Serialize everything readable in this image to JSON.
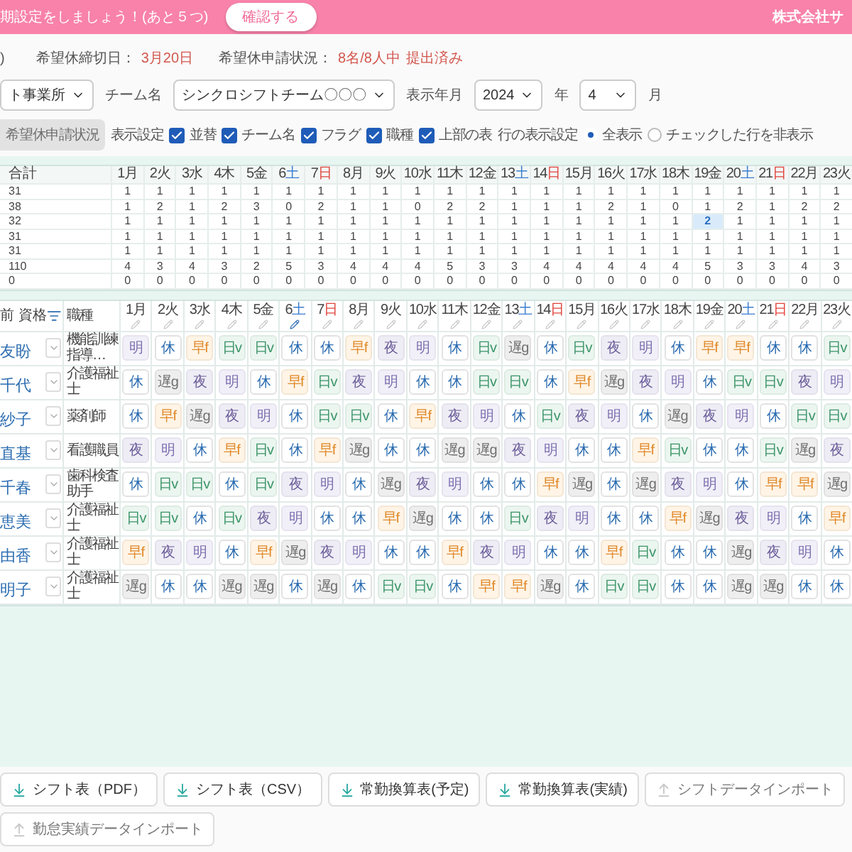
{
  "top_bar": {
    "message": "期設定をしましょう！(あと５つ)",
    "confirm_button": "確認する",
    "company": "株式会社サ"
  },
  "info": {
    "prefix": ")",
    "deadline_label": "希望休締切日：",
    "deadline": "3月20日",
    "status_label": "希望休申請状況：",
    "status_count": "8名/8人中",
    "status_text": "提出済み"
  },
  "filters": {
    "office": "ト事業所",
    "team_label": "チーム名",
    "team": "シンクロシフトチーム〇〇〇",
    "period_label": "表示年月",
    "year": "2024",
    "year_unit": "年",
    "month": "4",
    "month_unit": "月"
  },
  "settings": {
    "request_button": {
      "label": "希望休申請状況",
      "disabled": true
    },
    "display_label": "表示設定",
    "checkboxes": [
      {
        "label": "並替",
        "checked": true
      },
      {
        "label": "チーム名",
        "checked": true
      },
      {
        "label": "フラグ",
        "checked": true
      },
      {
        "label": "職種",
        "checked": true
      },
      {
        "label": "上部の表",
        "checked": true
      }
    ],
    "row_label": "行の表示設定",
    "radios": [
      {
        "label": "全表示",
        "selected": true
      },
      {
        "label": "チェックした行を非表示",
        "selected": false
      }
    ]
  },
  "summary": {
    "total_header": "合計",
    "columns": [
      {
        "day": "1",
        "weekday": "月",
        "kind": "weekday"
      },
      {
        "day": "2",
        "weekday": "火",
        "kind": "weekday"
      },
      {
        "day": "3",
        "weekday": "水",
        "kind": "weekday"
      },
      {
        "day": "4",
        "weekday": "木",
        "kind": "weekday"
      },
      {
        "day": "5",
        "weekday": "金",
        "kind": "weekday"
      },
      {
        "day": "6",
        "weekday": "土",
        "kind": "sat"
      },
      {
        "day": "7",
        "weekday": "日",
        "kind": "sun"
      },
      {
        "day": "8",
        "weekday": "月",
        "kind": "weekday"
      },
      {
        "day": "9",
        "weekday": "火",
        "kind": "weekday"
      },
      {
        "day": "10",
        "weekday": "水",
        "kind": "weekday"
      },
      {
        "day": "11",
        "weekday": "木",
        "kind": "weekday"
      },
      {
        "day": "12",
        "weekday": "金",
        "kind": "weekday"
      },
      {
        "day": "13",
        "weekday": "土",
        "kind": "sat"
      },
      {
        "day": "14",
        "weekday": "日",
        "kind": "sun"
      },
      {
        "day": "15",
        "weekday": "月",
        "kind": "weekday"
      },
      {
        "day": "16",
        "weekday": "火",
        "kind": "weekday"
      },
      {
        "day": "17",
        "weekday": "水",
        "kind": "weekday"
      },
      {
        "day": "18",
        "weekday": "木",
        "kind": "weekday"
      },
      {
        "day": "19",
        "weekday": "金",
        "kind": "weekday"
      },
      {
        "day": "20",
        "weekday": "土",
        "kind": "sat"
      },
      {
        "day": "21",
        "weekday": "日",
        "kind": "sun"
      },
      {
        "day": "22",
        "weekday": "月",
        "kind": "weekday"
      },
      {
        "day": "23",
        "weekday": "火",
        "kind": "weekday"
      }
    ],
    "rows": [
      {
        "total": "31",
        "values": [
          "1",
          "1",
          "1",
          "1",
          "1",
          "1",
          "1",
          "1",
          "1",
          "1",
          "1",
          "1",
          "1",
          "1",
          "1",
          "1",
          "1",
          "1",
          "1",
          "1",
          "1",
          "1",
          "1"
        ],
        "highlighted": [
          false,
          false,
          false,
          false,
          false,
          false,
          false,
          false,
          false,
          false,
          false,
          false,
          false,
          false,
          false,
          false,
          false,
          false,
          false,
          false,
          false,
          false,
          false
        ]
      },
      {
        "total": "38",
        "values": [
          "1",
          "2",
          "1",
          "2",
          "3",
          "0",
          "2",
          "1",
          "1",
          "0",
          "2",
          "2",
          "1",
          "1",
          "1",
          "2",
          "1",
          "0",
          "1",
          "2",
          "1",
          "2",
          "2"
        ],
        "highlighted": [
          false,
          false,
          false,
          false,
          false,
          false,
          false,
          false,
          false,
          false,
          false,
          false,
          false,
          false,
          false,
          false,
          false,
          false,
          false,
          false,
          false,
          false,
          false
        ]
      },
      {
        "total": "32",
        "values": [
          "1",
          "1",
          "1",
          "1",
          "1",
          "1",
          "1",
          "1",
          "1",
          "1",
          "1",
          "1",
          "1",
          "1",
          "1",
          "1",
          "1",
          "1",
          "2",
          "1",
          "1",
          "1",
          "1"
        ],
        "highlighted": [
          false,
          false,
          false,
          false,
          false,
          false,
          false,
          false,
          false,
          false,
          false,
          false,
          false,
          false,
          false,
          false,
          false,
          false,
          true,
          false,
          false,
          false,
          false
        ]
      },
      {
        "total": "31",
        "values": [
          "1",
          "1",
          "1",
          "1",
          "1",
          "1",
          "1",
          "1",
          "1",
          "1",
          "1",
          "1",
          "1",
          "1",
          "1",
          "1",
          "1",
          "1",
          "1",
          "1",
          "1",
          "1",
          "1"
        ],
        "highlighted": [
          false,
          false,
          false,
          false,
          false,
          false,
          false,
          false,
          false,
          false,
          false,
          false,
          false,
          false,
          false,
          false,
          false,
          false,
          false,
          false,
          false,
          false,
          false
        ]
      },
      {
        "total": "31",
        "values": [
          "1",
          "1",
          "1",
          "1",
          "1",
          "1",
          "1",
          "1",
          "1",
          "1",
          "1",
          "1",
          "1",
          "1",
          "1",
          "1",
          "1",
          "1",
          "1",
          "1",
          "1",
          "1",
          "1"
        ],
        "highlighted": [
          false,
          false,
          false,
          false,
          false,
          false,
          false,
          false,
          false,
          false,
          false,
          false,
          false,
          false,
          false,
          false,
          false,
          false,
          false,
          false,
          false,
          false,
          false
        ]
      },
      {
        "total": "110",
        "values": [
          "4",
          "3",
          "4",
          "3",
          "2",
          "5",
          "3",
          "4",
          "4",
          "4",
          "5",
          "3",
          "3",
          "4",
          "4",
          "4",
          "4",
          "4",
          "5",
          "3",
          "3",
          "4",
          "3"
        ],
        "highlighted": [
          false,
          false,
          false,
          false,
          false,
          false,
          false,
          false,
          false,
          false,
          false,
          false,
          false,
          false,
          false,
          false,
          false,
          false,
          false,
          false,
          false,
          false,
          false
        ]
      },
      {
        "total": "0",
        "values": [
          "0",
          "0",
          "0",
          "0",
          "0",
          "0",
          "0",
          "0",
          "0",
          "0",
          "0",
          "0",
          "0",
          "0",
          "0",
          "0",
          "0",
          "0",
          "0",
          "0",
          "0",
          "0",
          "0"
        ],
        "highlighted": [
          false,
          false,
          false,
          false,
          false,
          false,
          false,
          false,
          false,
          false,
          false,
          false,
          false,
          false,
          false,
          false,
          false,
          false,
          false,
          false,
          false,
          false,
          false
        ]
      }
    ]
  },
  "schedule": {
    "name_header": "前 資格",
    "job_header": "職種",
    "columns": [
      {
        "day": "1",
        "weekday": "月",
        "kind": "weekday",
        "selected": false
      },
      {
        "day": "2",
        "weekday": "火",
        "kind": "weekday",
        "selected": false
      },
      {
        "day": "3",
        "weekday": "水",
        "kind": "weekday",
        "selected": false
      },
      {
        "day": "4",
        "weekday": "木",
        "kind": "weekday",
        "selected": false
      },
      {
        "day": "5",
        "weekday": "金",
        "kind": "weekday",
        "selected": false
      },
      {
        "day": "6",
        "weekday": "土",
        "kind": "sat",
        "selected": true
      },
      {
        "day": "7",
        "weekday": "日",
        "kind": "sun",
        "selected": false
      },
      {
        "day": "8",
        "weekday": "月",
        "kind": "weekday",
        "selected": false
      },
      {
        "day": "9",
        "weekday": "火",
        "kind": "weekday",
        "selected": false
      },
      {
        "day": "10",
        "weekday": "水",
        "kind": "weekday",
        "selected": false
      },
      {
        "day": "11",
        "weekday": "木",
        "kind": "weekday",
        "selected": false
      },
      {
        "day": "12",
        "weekday": "金",
        "kind": "weekday",
        "selected": false
      },
      {
        "day": "13",
        "weekday": "土",
        "kind": "sat",
        "selected": false
      },
      {
        "day": "14",
        "weekday": "日",
        "kind": "sun",
        "selected": false
      },
      {
        "day": "15",
        "weekday": "月",
        "kind": "weekday",
        "selected": false
      },
      {
        "day": "16",
        "weekday": "火",
        "kind": "weekday",
        "selected": false
      },
      {
        "day": "17",
        "weekday": "水",
        "kind": "weekday",
        "selected": false
      },
      {
        "day": "18",
        "weekday": "木",
        "kind": "weekday",
        "selected": false
      },
      {
        "day": "19",
        "weekday": "金",
        "kind": "weekday",
        "selected": false
      },
      {
        "day": "20",
        "weekday": "土",
        "kind": "sat",
        "selected": false
      },
      {
        "day": "21",
        "weekday": "日",
        "kind": "sun",
        "selected": false
      },
      {
        "day": "22",
        "weekday": "月",
        "kind": "weekday",
        "selected": false
      },
      {
        "day": "23",
        "weekday": "火",
        "kind": "weekday",
        "selected": false
      }
    ],
    "rows": [
      {
        "name": "友盼",
        "job": "機能訓練指導…",
        "shifts": [
          {
            "label": "明",
            "kind": "ake"
          },
          {
            "label": "休",
            "kind": "off"
          },
          {
            "label": "早f",
            "kind": "early"
          },
          {
            "label": "日v",
            "kind": "day"
          },
          {
            "label": "日v",
            "kind": "day"
          },
          {
            "label": "休",
            "kind": "off"
          },
          {
            "label": "休",
            "kind": "off"
          },
          {
            "label": "早f",
            "kind": "early"
          },
          {
            "label": "夜",
            "kind": "night"
          },
          {
            "label": "明",
            "kind": "ake"
          },
          {
            "label": "休",
            "kind": "off"
          },
          {
            "label": "日v",
            "kind": "day"
          },
          {
            "label": "遅g",
            "kind": "late"
          },
          {
            "label": "休",
            "kind": "off"
          },
          {
            "label": "日v",
            "kind": "day"
          },
          {
            "label": "夜",
            "kind": "night"
          },
          {
            "label": "明",
            "kind": "ake"
          },
          {
            "label": "休",
            "kind": "off"
          },
          {
            "label": "早f",
            "kind": "early"
          },
          {
            "label": "早f",
            "kind": "early"
          },
          {
            "label": "休",
            "kind": "off"
          },
          {
            "label": "休",
            "kind": "off"
          },
          {
            "label": "日v",
            "kind": "day"
          }
        ]
      },
      {
        "name": "千代",
        "job": "介護福祉士",
        "shifts": [
          {
            "label": "休",
            "kind": "off"
          },
          {
            "label": "遅g",
            "kind": "late"
          },
          {
            "label": "夜",
            "kind": "night"
          },
          {
            "label": "明",
            "kind": "ake"
          },
          {
            "label": "休",
            "kind": "off"
          },
          {
            "label": "早f",
            "kind": "early"
          },
          {
            "label": "日v",
            "kind": "day"
          },
          {
            "label": "夜",
            "kind": "night"
          },
          {
            "label": "明",
            "kind": "ake"
          },
          {
            "label": "休",
            "kind": "off"
          },
          {
            "label": "休",
            "kind": "off"
          },
          {
            "label": "日v",
            "kind": "day"
          },
          {
            "label": "日v",
            "kind": "day"
          },
          {
            "label": "休",
            "kind": "off"
          },
          {
            "label": "早f",
            "kind": "early"
          },
          {
            "label": "遅g",
            "kind": "late"
          },
          {
            "label": "夜",
            "kind": "night"
          },
          {
            "label": "明",
            "kind": "ake"
          },
          {
            "label": "休",
            "kind": "off"
          },
          {
            "label": "日v",
            "kind": "day"
          },
          {
            "label": "日v",
            "kind": "day"
          },
          {
            "label": "夜",
            "kind": "night"
          },
          {
            "label": "明",
            "kind": "ake"
          }
        ]
      },
      {
        "name": "紗子",
        "job": "薬剤師",
        "shifts": [
          {
            "label": "休",
            "kind": "off"
          },
          {
            "label": "早f",
            "kind": "early"
          },
          {
            "label": "遅g",
            "kind": "late"
          },
          {
            "label": "夜",
            "kind": "night"
          },
          {
            "label": "明",
            "kind": "ake"
          },
          {
            "label": "休",
            "kind": "off"
          },
          {
            "label": "日v",
            "kind": "day"
          },
          {
            "label": "日v",
            "kind": "day"
          },
          {
            "label": "休",
            "kind": "off"
          },
          {
            "label": "早f",
            "kind": "early"
          },
          {
            "label": "夜",
            "kind": "night"
          },
          {
            "label": "明",
            "kind": "ake"
          },
          {
            "label": "休",
            "kind": "off"
          },
          {
            "label": "日v",
            "kind": "day"
          },
          {
            "label": "夜",
            "kind": "night"
          },
          {
            "label": "明",
            "kind": "ake"
          },
          {
            "label": "休",
            "kind": "off"
          },
          {
            "label": "遅g",
            "kind": "late"
          },
          {
            "label": "夜",
            "kind": "night"
          },
          {
            "label": "明",
            "kind": "ake"
          },
          {
            "label": "休",
            "kind": "off"
          },
          {
            "label": "日v",
            "kind": "day"
          },
          {
            "label": "日v",
            "kind": "day"
          }
        ]
      },
      {
        "name": "直基",
        "job": "看護職員",
        "shifts": [
          {
            "label": "夜",
            "kind": "night"
          },
          {
            "label": "明",
            "kind": "ake"
          },
          {
            "label": "休",
            "kind": "off"
          },
          {
            "label": "早f",
            "kind": "early"
          },
          {
            "label": "日v",
            "kind": "day"
          },
          {
            "label": "休",
            "kind": "off"
          },
          {
            "label": "早f",
            "kind": "early"
          },
          {
            "label": "遅g",
            "kind": "late"
          },
          {
            "label": "休",
            "kind": "off"
          },
          {
            "label": "休",
            "kind": "off"
          },
          {
            "label": "遅g",
            "kind": "late"
          },
          {
            "label": "遅g",
            "kind": "late"
          },
          {
            "label": "夜",
            "kind": "night"
          },
          {
            "label": "明",
            "kind": "ake"
          },
          {
            "label": "休",
            "kind": "off"
          },
          {
            "label": "休",
            "kind": "off"
          },
          {
            "label": "早f",
            "kind": "early"
          },
          {
            "label": "日v",
            "kind": "day"
          },
          {
            "label": "休",
            "kind": "off"
          },
          {
            "label": "休",
            "kind": "off"
          },
          {
            "label": "日v",
            "kind": "day"
          },
          {
            "label": "遅g",
            "kind": "late"
          },
          {
            "label": "夜",
            "kind": "night"
          }
        ]
      },
      {
        "name": "千春",
        "job": "歯科検査助手",
        "shifts": [
          {
            "label": "休",
            "kind": "off"
          },
          {
            "label": "日v",
            "kind": "day"
          },
          {
            "label": "日v",
            "kind": "day"
          },
          {
            "label": "休",
            "kind": "off"
          },
          {
            "label": "日v",
            "kind": "day"
          },
          {
            "label": "夜",
            "kind": "night"
          },
          {
            "label": "明",
            "kind": "ake"
          },
          {
            "label": "休",
            "kind": "off"
          },
          {
            "label": "遅g",
            "kind": "late"
          },
          {
            "label": "夜",
            "kind": "night"
          },
          {
            "label": "明",
            "kind": "ake"
          },
          {
            "label": "休",
            "kind": "off"
          },
          {
            "label": "休",
            "kind": "off"
          },
          {
            "label": "早f",
            "kind": "early"
          },
          {
            "label": "遅g",
            "kind": "late"
          },
          {
            "label": "休",
            "kind": "off"
          },
          {
            "label": "遅g",
            "kind": "late"
          },
          {
            "label": "夜",
            "kind": "night"
          },
          {
            "label": "明",
            "kind": "ake"
          },
          {
            "label": "休",
            "kind": "off"
          },
          {
            "label": "早f",
            "kind": "early"
          },
          {
            "label": "早f",
            "kind": "early"
          },
          {
            "label": "遅g",
            "kind": "late"
          }
        ]
      },
      {
        "name": "恵美",
        "job": "介護福祉士",
        "shifts": [
          {
            "label": "日v",
            "kind": "day"
          },
          {
            "label": "日v",
            "kind": "day"
          },
          {
            "label": "休",
            "kind": "off"
          },
          {
            "label": "日v",
            "kind": "day"
          },
          {
            "label": "夜",
            "kind": "night"
          },
          {
            "label": "明",
            "kind": "ake"
          },
          {
            "label": "休",
            "kind": "off"
          },
          {
            "label": "休",
            "kind": "off"
          },
          {
            "label": "早f",
            "kind": "early"
          },
          {
            "label": "遅g",
            "kind": "late"
          },
          {
            "label": "休",
            "kind": "off"
          },
          {
            "label": "休",
            "kind": "off"
          },
          {
            "label": "日v",
            "kind": "day"
          },
          {
            "label": "夜",
            "kind": "night"
          },
          {
            "label": "明",
            "kind": "ake"
          },
          {
            "label": "休",
            "kind": "off"
          },
          {
            "label": "休",
            "kind": "off"
          },
          {
            "label": "早f",
            "kind": "early"
          },
          {
            "label": "遅g",
            "kind": "late"
          },
          {
            "label": "夜",
            "kind": "night"
          },
          {
            "label": "明",
            "kind": "ake"
          },
          {
            "label": "休",
            "kind": "off"
          },
          {
            "label": "早f",
            "kind": "early"
          }
        ]
      },
      {
        "name": "由香",
        "job": "介護福祉士",
        "shifts": [
          {
            "label": "早f",
            "kind": "early"
          },
          {
            "label": "夜",
            "kind": "night"
          },
          {
            "label": "明",
            "kind": "ake"
          },
          {
            "label": "休",
            "kind": "off"
          },
          {
            "label": "早f",
            "kind": "early"
          },
          {
            "label": "遅g",
            "kind": "late"
          },
          {
            "label": "夜",
            "kind": "night"
          },
          {
            "label": "明",
            "kind": "ake"
          },
          {
            "label": "休",
            "kind": "off"
          },
          {
            "label": "休",
            "kind": "off"
          },
          {
            "label": "早f",
            "kind": "early"
          },
          {
            "label": "夜",
            "kind": "night"
          },
          {
            "label": "明",
            "kind": "ake"
          },
          {
            "label": "休",
            "kind": "off"
          },
          {
            "label": "休",
            "kind": "off"
          },
          {
            "label": "早f",
            "kind": "early"
          },
          {
            "label": "日v",
            "kind": "day"
          },
          {
            "label": "休",
            "kind": "off"
          },
          {
            "label": "休",
            "kind": "off"
          },
          {
            "label": "遅g",
            "kind": "late"
          },
          {
            "label": "夜",
            "kind": "night"
          },
          {
            "label": "明",
            "kind": "ake"
          },
          {
            "label": "休",
            "kind": "off"
          }
        ]
      },
      {
        "name": "明子",
        "job": "介護福祉士",
        "shifts": [
          {
            "label": "遅g",
            "kind": "late"
          },
          {
            "label": "休",
            "kind": "off"
          },
          {
            "label": "休",
            "kind": "off"
          },
          {
            "label": "遅g",
            "kind": "late"
          },
          {
            "label": "遅g",
            "kind": "late"
          },
          {
            "label": "休",
            "kind": "off"
          },
          {
            "label": "遅g",
            "kind": "late"
          },
          {
            "label": "休",
            "kind": "off"
          },
          {
            "label": "日v",
            "kind": "day"
          },
          {
            "label": "日v",
            "kind": "day"
          },
          {
            "label": "休",
            "kind": "off"
          },
          {
            "label": "早f",
            "kind": "early"
          },
          {
            "label": "早f",
            "kind": "early"
          },
          {
            "label": "遅g",
            "kind": "late"
          },
          {
            "label": "休",
            "kind": "off"
          },
          {
            "label": "日v",
            "kind": "day"
          },
          {
            "label": "日v",
            "kind": "day"
          },
          {
            "label": "休",
            "kind": "off"
          },
          {
            "label": "休",
            "kind": "off"
          },
          {
            "label": "遅g",
            "kind": "late"
          },
          {
            "label": "遅g",
            "kind": "late"
          },
          {
            "label": "休",
            "kind": "off"
          },
          {
            "label": "休",
            "kind": "off"
          }
        ]
      }
    ]
  },
  "footer_buttons": [
    {
      "label": "シフト表（PDF）",
      "kind": "download",
      "disabled": false
    },
    {
      "label": "シフト表（CSV）",
      "kind": "download",
      "disabled": false
    },
    {
      "label": "常勤換算表(予定)",
      "kind": "download",
      "disabled": false
    },
    {
      "label": "常勤換算表(実績)",
      "kind": "download",
      "disabled": false
    },
    {
      "label": "シフトデータインポート",
      "kind": "import",
      "disabled": true
    },
    {
      "label": "勤怠実績データインポート",
      "kind": "import",
      "disabled": true
    }
  ]
}
